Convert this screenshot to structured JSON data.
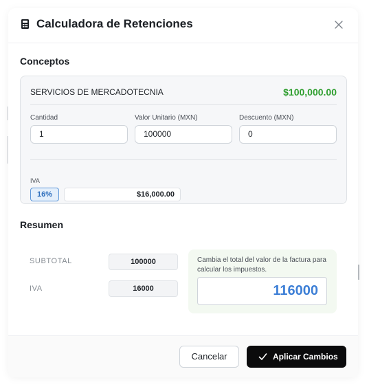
{
  "header": {
    "title": "Calculadora de Retenciones",
    "icons": {
      "calculator": "calculator-icon",
      "close": "close-icon"
    }
  },
  "concepts": {
    "section_title": "Conceptos",
    "item": {
      "name": "SERVICIOS DE MERCADOTECNIA",
      "total": "$100,000.00",
      "fields": {
        "quantity_label": "Cantidad",
        "quantity_value": "1",
        "unit_value_label": "Valor Unitario (MXN)",
        "unit_value_value": "100000",
        "discount_label": "Descuento (MXN)",
        "discount_value": "0"
      },
      "iva": {
        "label": "IVA",
        "rate": "16%",
        "amount": "$16,000.00"
      }
    }
  },
  "summary": {
    "section_title": "Resumen",
    "subtotal_label": "SUBTOTAL",
    "subtotal_value": "100000",
    "iva_label": "IVA",
    "iva_value": "16000",
    "total_hint": "Cambia el total del valor de la factura para calcular los impuestos.",
    "total_value": "116000"
  },
  "footer": {
    "cancel_label": "Cancelar",
    "apply_label": "Aplicar Cambios"
  },
  "colors": {
    "accent_green": "#2f9e2f",
    "accent_blue": "#3d7fd6",
    "primary_button": "#0b0b0c"
  }
}
